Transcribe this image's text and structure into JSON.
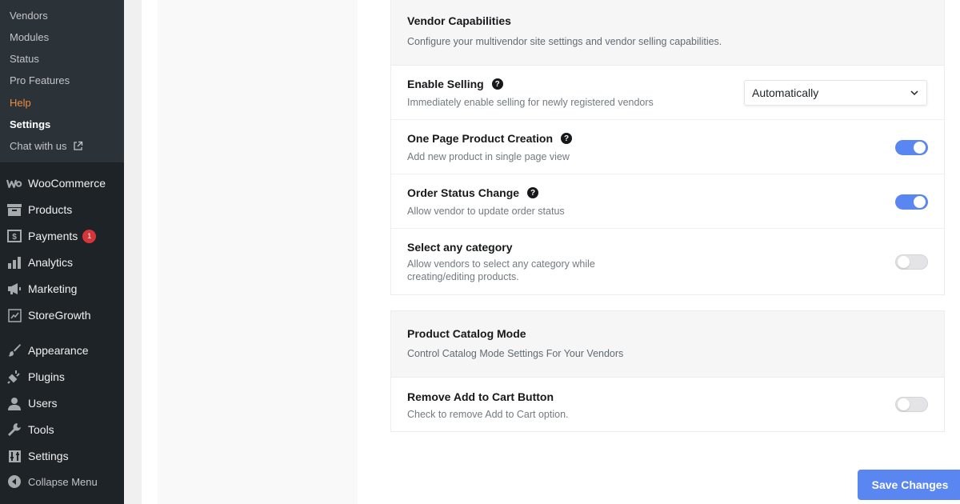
{
  "sidebar": {
    "submenu": [
      {
        "label": "Vendors"
      },
      {
        "label": "Modules"
      },
      {
        "label": "Status"
      },
      {
        "label": "Pro Features"
      },
      {
        "label": "Help"
      },
      {
        "label": "Settings"
      },
      {
        "label": "Chat with us"
      }
    ],
    "menu": [
      {
        "label": "WooCommerce",
        "icon": "woocommerce-icon"
      },
      {
        "label": "Products",
        "icon": "products-icon"
      },
      {
        "label": "Payments",
        "icon": "payments-icon",
        "badge": "1"
      },
      {
        "label": "Analytics",
        "icon": "analytics-icon"
      },
      {
        "label": "Marketing",
        "icon": "megaphone-icon"
      },
      {
        "label": "StoreGrowth",
        "icon": "storegrowth-icon"
      },
      {
        "label": "Appearance",
        "icon": "brush-icon"
      },
      {
        "label": "Plugins",
        "icon": "plugin-icon"
      },
      {
        "label": "Users",
        "icon": "user-icon"
      },
      {
        "label": "Tools",
        "icon": "wrench-icon"
      },
      {
        "label": "Settings",
        "icon": "settings-icon"
      },
      {
        "label": "Collapse Menu",
        "icon": "collapse-icon"
      }
    ]
  },
  "vendor_capabilities": {
    "title": "Vendor Capabilities",
    "description": "Configure your multivendor site settings and vendor selling capabilities.",
    "rows": [
      {
        "title": "Enable Selling",
        "description": "Immediately enable selling for newly registered vendors",
        "control": "select",
        "value": "Automatically"
      },
      {
        "title": "One Page Product Creation",
        "description": "Add new product in single page view",
        "control": "toggle",
        "on": true
      },
      {
        "title": "Order Status Change",
        "description": "Allow vendor to update order status",
        "control": "toggle",
        "on": true
      },
      {
        "title": "Select any category",
        "description": "Allow vendors to select any category while creating/editing products.",
        "control": "toggle",
        "on": false
      }
    ]
  },
  "catalog_mode": {
    "title": "Product Catalog Mode",
    "description": "Control Catalog Mode Settings For Your Vendors",
    "rows": [
      {
        "title": "Remove Add to Cart Button",
        "description": "Check to remove Add to Cart option.",
        "control": "toggle",
        "on": false
      }
    ]
  },
  "actions": {
    "save_label": "Save Changes"
  },
  "colors": {
    "sidebar_bg": "#1d2327",
    "submenu_bg": "#2c3338",
    "help_link": "#f18a3f",
    "accent": "#5a86f1",
    "badge": "#d63638"
  }
}
